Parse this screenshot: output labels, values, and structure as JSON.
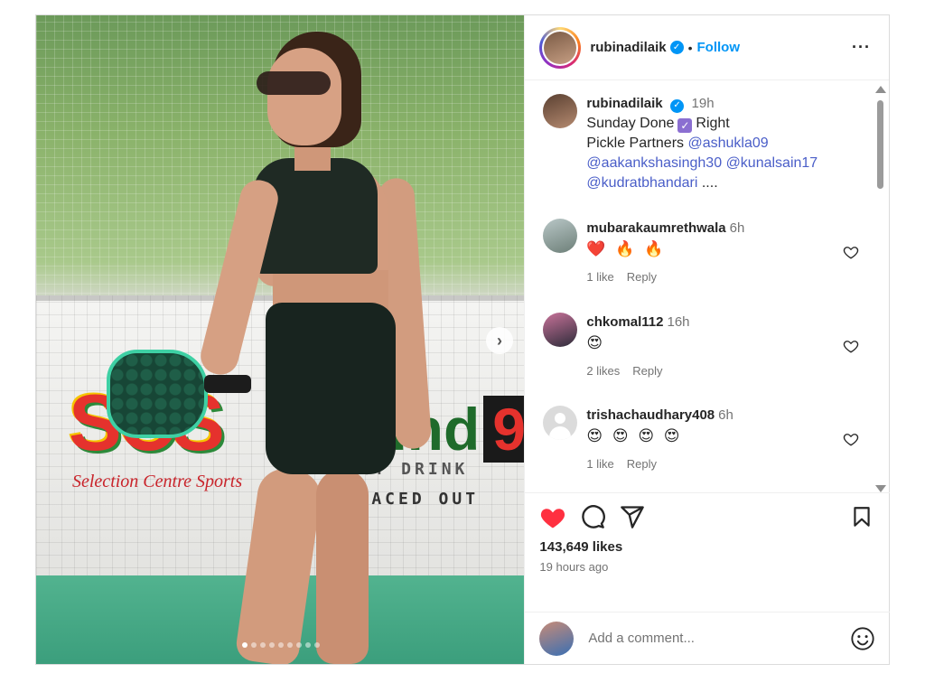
{
  "post": {
    "username": "rubinadilaik",
    "follow_label": "Follow",
    "more_label": "···",
    "next_glyph": "›",
    "slide_count": 9,
    "active_slide": 1
  },
  "caption": {
    "username": "rubinadilaik",
    "time": "19h",
    "line1": "Sunday Done",
    "line1_end": "Right",
    "line2_prefix": "Pickle Partners",
    "mention1": "@ashukla09",
    "mention2": "@aakankshasingh30",
    "mention3": "@kunalsain17",
    "mention4": "@kudratbhandari",
    "ellipsis": "...."
  },
  "comments": [
    {
      "username": "mubarakaumrethwala",
      "time": "6h",
      "text": "❤️ 🔥 🔥",
      "likes": "1 like",
      "reply": "Reply"
    },
    {
      "username": "chkomal112",
      "time": "16h",
      "text": "😍",
      "likes": "2 likes",
      "reply": "Reply"
    },
    {
      "username": "trishachaudhary408",
      "time": "6h",
      "text": "😍 😍 😍 😍",
      "likes": "1 like",
      "reply": "Reply"
    }
  ],
  "stats": {
    "likes": "143,649 likes",
    "posted": "19 hours ago"
  },
  "add_comment": {
    "placeholder": "Add a comment..."
  },
  "photo_text": {
    "brand1": "SCS",
    "brand1_sub": "Selection Centre Sports",
    "brand2_prefix": "ound",
    "brand2_digit": "9",
    "brand2_sub1": "ERGY DRINK",
    "brand2_sub2": "T SPACED OUT"
  },
  "colors": {
    "accent": "#0095f6",
    "like_red": "#ff3040",
    "mention": "#4a5ec8"
  },
  "icons": [
    "verified-icon",
    "more-icon",
    "heart-icon",
    "comment-icon",
    "share-icon",
    "bookmark-icon",
    "emoji-icon",
    "next-arrow-icon"
  ]
}
